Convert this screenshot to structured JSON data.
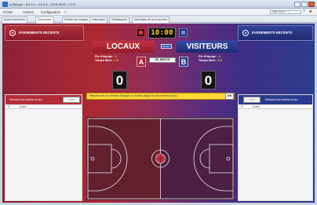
{
  "window": {
    "title": "e-Marque - 6.6.5.4 - 4.0.4.5 - 2015-2016 - 1.0.6"
  },
  "menu": {
    "items": [
      "Fichier",
      "Actions",
      "Configuration",
      "?"
    ],
    "help_placeholder": "Mise à jour... ?",
    "help_icon": "?",
    "user_icon": "person-icon"
  },
  "tabs": [
    {
      "label": "Avant-rencontre",
      "active": false
    },
    {
      "label": "Rencontre",
      "active": true
    },
    {
      "label": "Feuille de marque",
      "active": false
    },
    {
      "label": "Historique",
      "active": false
    },
    {
      "label": "Statistiques",
      "active": false
    },
    {
      "label": "Résultats de la rencontre",
      "active": false
    }
  ],
  "events": {
    "home_title": "EVENEMENTS RECENTS",
    "away_title": "EVENEMENTS RECENTS"
  },
  "clock": "10:00",
  "reset_label": "RESET",
  "teams": {
    "home": {
      "name": "LOCAUX",
      "letter": "A",
      "fouls_label": "Fte d'équipe :",
      "fouls": "1",
      "timeouts_label": "Temps Mort :",
      "timeouts": "1.0",
      "score": "0"
    },
    "away": {
      "name": "VISITEURS",
      "letter": "B",
      "fouls_label": "Fte d'équipe :",
      "fouls": "1",
      "timeouts_label": "Temps Mort :",
      "timeouts": "0.0",
      "score": "0"
    }
  },
  "match_button": "AV. MATCH",
  "info_message": "Sélectionnez un membre d'équipe ou double-cliquez sur les entrées en jeu",
  "ok_label": "OK",
  "lists": {
    "home": {
      "label": "Sélection des entrées en jeu",
      "search_placeholder": "Saisir",
      "row": [
        "N°",
        "Joueur"
      ]
    },
    "away": {
      "label": "Sélection des entrées en jeu",
      "search_placeholder": "Saisir",
      "row": [
        "N°",
        "Joueur"
      ]
    }
  },
  "colors": {
    "home": "#a8262f",
    "away": "#263b8c",
    "clock_digits": "#ffd21a",
    "info_bar": "#ffd93a"
  }
}
